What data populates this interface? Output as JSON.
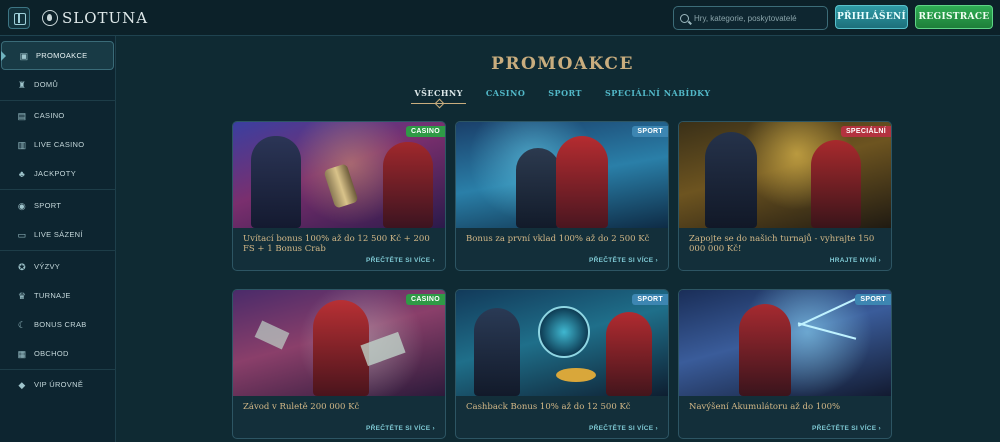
{
  "header": {
    "logo_text": "SLOTUNA",
    "search_placeholder": "Hry, kategorie, poskytovatelé",
    "login_label": "PŘIHLÁŠENÍ",
    "register_label": "REGISTRACE"
  },
  "sidebar": {
    "items": [
      {
        "label": "PROMOAKCE",
        "icon": "gift-icon"
      },
      {
        "label": "DOMŮ",
        "icon": "castle-icon"
      },
      {
        "label": "CASINO",
        "icon": "slot-icon"
      },
      {
        "label": "LIVE CASINO",
        "icon": "cards-icon"
      },
      {
        "label": "JACKPOTY",
        "icon": "clover-icon"
      },
      {
        "label": "SPORT",
        "icon": "ball-icon"
      },
      {
        "label": "LIVE SÁZENÍ",
        "icon": "screen-icon"
      },
      {
        "label": "VÝZVY",
        "icon": "medal-icon"
      },
      {
        "label": "TURNAJE",
        "icon": "trophy-icon"
      },
      {
        "label": "BONUS CRAB",
        "icon": "crab-icon"
      },
      {
        "label": "OBCHOD",
        "icon": "shop-icon"
      },
      {
        "label": "VIP ÚROVNĚ",
        "icon": "diamond-icon"
      }
    ]
  },
  "main": {
    "title": "PROMOAKCE",
    "tabs": [
      "VŠECHNY",
      "CASINO",
      "SPORT",
      "SPECIÁLNÍ NABÍDKY"
    ],
    "active_tab": "VŠECHNY"
  },
  "promos": [
    {
      "badge": "CASINO",
      "title": "Uvítací bonus 100% až do 12 500 Kč + 200 FS + 1 Bonus Crab",
      "link": "PŘEČTĚTE SI VÍCE ›"
    },
    {
      "badge": "SPORT",
      "title": "Bonus za první vklad 100% až do 2 500 Kč",
      "link": "PŘEČTĚTE SI VÍCE ›"
    },
    {
      "badge": "SPECIÁLNÍ",
      "title": "Zapojte se do našich turnajů - vyhrajte 150 000 000 Kč!",
      "link": "HRAJTE NYNÍ ›"
    },
    {
      "badge": "CASINO",
      "title": "Závod v Ruletě 200 000 Kč",
      "link": "PŘEČTĚTE SI VÍCE ›"
    },
    {
      "badge": "SPORT",
      "title": "Cashback Bonus 10% až do 12 500 Kč",
      "link": "PŘEČTĚTE SI VÍCE ›"
    },
    {
      "badge": "SPORT",
      "title": "Navýšení Akumulátoru až do 100%",
      "link": "PŘEČTĚTE SI VÍCE ›"
    }
  ]
}
